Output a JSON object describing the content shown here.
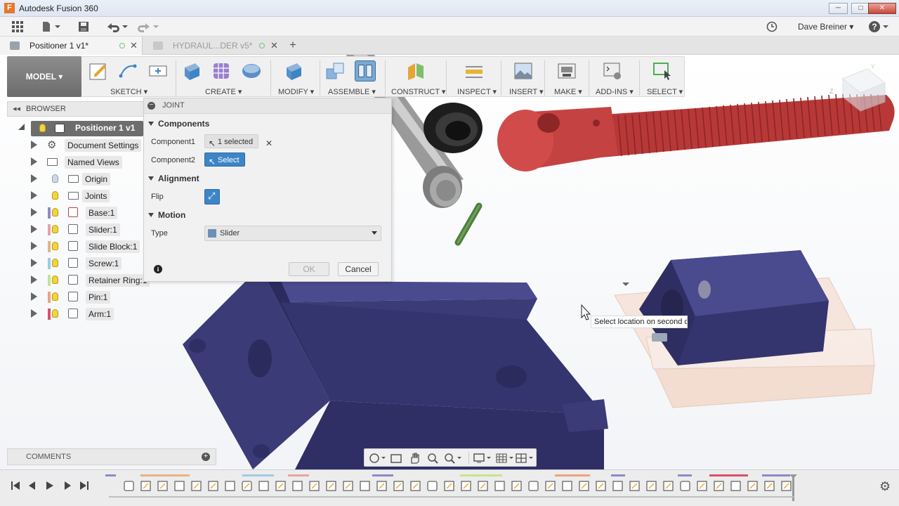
{
  "window": {
    "app_title": "Autodesk Fusion 360",
    "minimize": "─",
    "maximize": "□",
    "close": "✕"
  },
  "quick_access": {
    "user_name": "Dave Breiner",
    "user_caret": "▾",
    "help_caret": "▾"
  },
  "tabs": [
    {
      "label": "Positioner 1 v1*",
      "close": "✕"
    },
    {
      "label": "HYDRAUL...DER v5*",
      "close": "✕"
    }
  ],
  "tab_add": "+",
  "workspace": {
    "label": "MODEL ▾"
  },
  "toolbar": {
    "groups": [
      {
        "label": "SKETCH ▾"
      },
      {
        "label": "CREATE ▾"
      },
      {
        "label": "MODIFY ▾"
      },
      {
        "label": "ASSEMBLE ▾"
      },
      {
        "label": "CONSTRUCT ▾"
      },
      {
        "label": "INSPECT ▾"
      },
      {
        "label": "INSERT ▾"
      },
      {
        "label": "MAKE ▾"
      },
      {
        "label": "ADD-INS ▾"
      },
      {
        "label": "SELECT ▾"
      }
    ]
  },
  "browser": {
    "title": "BROWSER",
    "collapse": "◂◂",
    "root": "Positioner 1 v1",
    "items": [
      {
        "label": "Document Settings",
        "color": ""
      },
      {
        "label": "Named Views",
        "color": ""
      },
      {
        "label": "Origin",
        "color": ""
      },
      {
        "label": "Joints",
        "color": ""
      },
      {
        "label": "Base:1",
        "color": "#8e89c9"
      },
      {
        "label": "Slider:1",
        "color": "#e7a3a3"
      },
      {
        "label": "Slide Block:1",
        "color": "#e9b383"
      },
      {
        "label": "Screw:1",
        "color": "#9ecbe8"
      },
      {
        "label": "Retainer Ring:1",
        "color": "#c9e28a"
      },
      {
        "label": "Pin:1",
        "color": "#efa27c"
      },
      {
        "label": "Arm:1",
        "color": "#d9506a"
      }
    ]
  },
  "joint_dialog": {
    "title": "JOINT",
    "minus": "−",
    "components_section": "Components",
    "component1_label": "Component1",
    "component1_value": "1 selected",
    "component1_clear": "✕",
    "component2_label": "Component2",
    "component2_value": "Select",
    "alignment_section": "Alignment",
    "flip_label": "Flip",
    "motion_section": "Motion",
    "type_label": "Type",
    "type_value": "Slider",
    "info": "i",
    "ok_label": "OK",
    "cancel_label": "Cancel"
  },
  "tooltip": {
    "text": "Select location on second co"
  },
  "comments": {
    "label": "COMMENTS",
    "plus": "+"
  },
  "colors": {
    "part_navy": "#3a3a72",
    "screw_red": "#c84a4a",
    "pin_green": "#5f8f4a",
    "accent_blue": "#3d85c6"
  }
}
